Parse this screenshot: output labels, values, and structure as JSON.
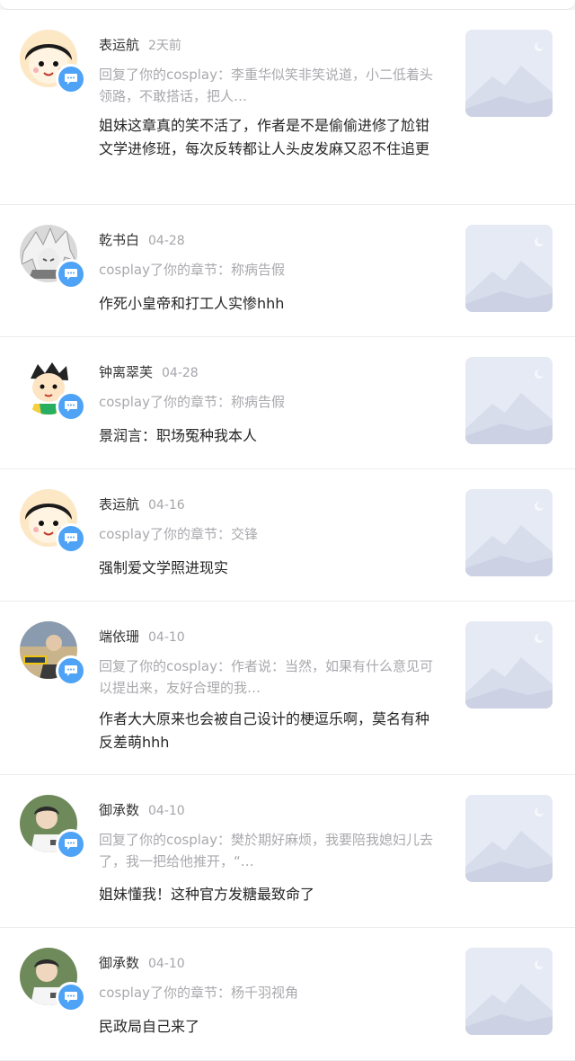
{
  "notifications": [
    {
      "name": "表运航",
      "time": "2天前",
      "context": "回复了你的cosplay：李重华似笑非笑说道，小二低着头领路，不敢搭话，把人…",
      "content": "姐妹这章真的笑不活了，作者是不是偷偷进修了尬钳文学进修班，每次反转都让人头皮发麻又忍不住追更",
      "avatar": "cartoon-girl-avatar"
    },
    {
      "name": "乾书白",
      "time": "04-28",
      "context": "cosplay了你的章节：称病告假",
      "content": "作死小皇帝和打工人实惨hhh",
      "avatar": "anime-silver-hair-avatar"
    },
    {
      "name": "钟离翠芙",
      "time": "04-28",
      "context": "cosplay了你的章节：称病告假",
      "content": "景润言：职场冤种我本人",
      "avatar": "cartoon-kid-avatar"
    },
    {
      "name": "表运航",
      "time": "04-16",
      "context": "cosplay了你的章节：交锋",
      "content": "强制爱文学照进现实",
      "avatar": "cartoon-girl-avatar"
    },
    {
      "name": "端依珊",
      "time": "04-10",
      "context": "回复了你的cosplay：作者说：当然，如果有什么意见可以提出来，友好合理的我…",
      "content": "作者大大原来也会被自己设计的梗逗乐啊，莫名有种反差萌hhh",
      "avatar": "photo-avatar"
    },
    {
      "name": "御承数",
      "time": "04-10",
      "context": "回复了你的cosplay：樊於期好麻烦，我要陪我媳妇儿去了，我一把给他推开，“…",
      "content": "姐妹懂我！这种官方发糖最致命了",
      "avatar": "photo-person-avatar"
    },
    {
      "name": "御承数",
      "time": "04-10",
      "context": "cosplay了你的章节：杨千羽视角",
      "content": "民政局自己来了",
      "avatar": "photo-person-avatar"
    }
  ],
  "colors": {
    "badge": "#4ea3f6",
    "name": "#333333",
    "muted": "#a9a9ae",
    "thumb_bg": "#e6eaf5"
  },
  "icons": {
    "badge": "comment-bubble-icon",
    "thumb": "mountain-placeholder-icon"
  }
}
